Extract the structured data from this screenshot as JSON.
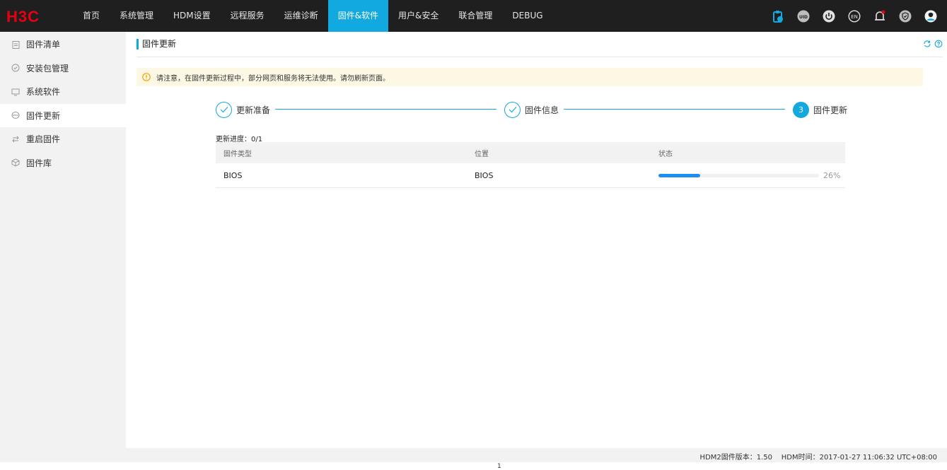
{
  "brand": {
    "logo_text": "H3C",
    "logo_color": "#e60012"
  },
  "colors": {
    "accent": "#12a8e0",
    "progress": "#1d8ff0",
    "warning": "#f2a100",
    "notice_bg": "#fdf8e4",
    "topbar_bg": "#1f1f1f"
  },
  "nav": {
    "items": [
      {
        "label": "首页"
      },
      {
        "label": "系统管理"
      },
      {
        "label": "HDM设置"
      },
      {
        "label": "远程服务"
      },
      {
        "label": "运维诊断"
      },
      {
        "label": "固件&软件",
        "active": true
      },
      {
        "label": "用户&安全"
      },
      {
        "label": "联合管理"
      },
      {
        "label": "DEBUG"
      }
    ]
  },
  "top_icons": [
    {
      "name": "clipboard-icon"
    },
    {
      "name": "uid-icon",
      "text": "UID"
    },
    {
      "name": "power-icon"
    },
    {
      "name": "language-icon",
      "text": "EN"
    },
    {
      "name": "bell-icon"
    },
    {
      "name": "shield-icon"
    },
    {
      "name": "user-avatar-icon"
    }
  ],
  "sidebar": {
    "items": [
      {
        "label": "固件清单",
        "icon": "clipboard-icon"
      },
      {
        "label": "安装包管理",
        "icon": "package-icon"
      },
      {
        "label": "系统软件",
        "icon": "monitor-icon"
      },
      {
        "label": "固件更新",
        "icon": "update-icon",
        "active": true
      },
      {
        "label": "重启固件",
        "icon": "restart-icon"
      },
      {
        "label": "固件库",
        "icon": "cube-icon"
      }
    ]
  },
  "page": {
    "title": "固件更新",
    "notice": "请注意，在固件更新过程中，部分网页和服务将无法使用。请勿刷新页面。"
  },
  "steps": [
    {
      "label": "更新准备",
      "status": "done"
    },
    {
      "label": "固件信息",
      "status": "done"
    },
    {
      "label": "固件更新",
      "status": "current",
      "number": "3"
    }
  ],
  "progress": {
    "label": "更新进度：0/1"
  },
  "table": {
    "headers": [
      "固件类型",
      "位置",
      "状态"
    ],
    "rows": [
      {
        "type": "BIOS",
        "location": "BIOS",
        "status_percent": 26,
        "status_text": "26%"
      }
    ]
  },
  "footer": {
    "text": "HDM2固件版本：1.50    HDM时间：2017-01-27 11:06:32 UTC+08:00"
  },
  "bottom_mark": "1"
}
